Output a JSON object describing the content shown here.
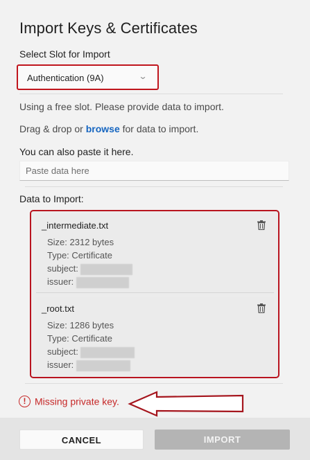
{
  "dialog": {
    "title": "Import Keys & Certificates",
    "slot_label": "Select Slot for Import",
    "slot_value": "Authentication (9A)",
    "free_slot_text": "Using a free slot. Please provide data to import.",
    "drag_prefix": "Drag & drop or ",
    "drag_link": "browse",
    "drag_suffix": " for data to import.",
    "paste_label": "You can also paste it here.",
    "paste_placeholder": "Paste data here",
    "data_label": "Data to Import:",
    "files": [
      {
        "name": "_intermediate.txt",
        "size": "Size: 2312 bytes",
        "type": "Type: Certificate",
        "subject": "subject:",
        "issuer": "issuer:"
      },
      {
        "name": "_root.txt",
        "size": "Size: 1286 bytes",
        "type": "Type: Certificate",
        "subject": "subject:",
        "issuer": "issuer:"
      }
    ],
    "error_icon": "!",
    "error_text": "Missing private key.",
    "cancel_label": "CANCEL",
    "import_label": "IMPORT"
  },
  "icons": {
    "chevron": "chevron-down-icon",
    "trash": "trash-icon",
    "error": "error-circle-icon",
    "arrow": "annotation-arrow-left"
  },
  "colors": {
    "highlight": "#c0151d",
    "link": "#1565c0",
    "error": "#c62828",
    "import_disabled": "#b4b4b4"
  }
}
